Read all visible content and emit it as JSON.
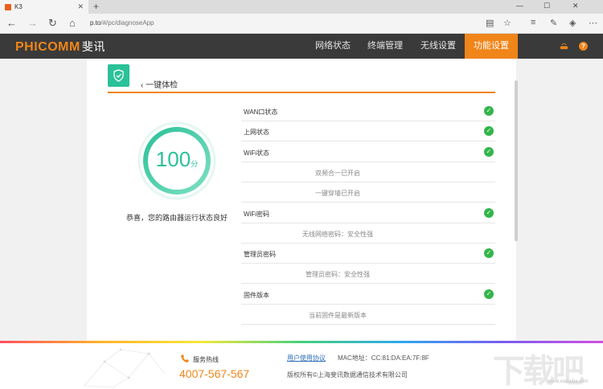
{
  "browser": {
    "tab_title": "K3",
    "url_host": "p.to",
    "url_path": "/#/pc/diagnoseApp"
  },
  "header": {
    "logo": "PHICOMM",
    "logo_cn": "斐讯",
    "nav": [
      {
        "label": "网络状态"
      },
      {
        "label": "终端管理"
      },
      {
        "label": "无线设置"
      },
      {
        "label": "功能设置"
      }
    ],
    "active_nav": "功能设置"
  },
  "page": {
    "title": "一键体检",
    "score": "100",
    "score_unit": "分",
    "message": "恭喜，您的路由器运行状态良好"
  },
  "checks": [
    {
      "label": "WAN口状态",
      "ok": true
    },
    {
      "label": "上网状态",
      "ok": true
    },
    {
      "label": "WiFi状态",
      "ok": true
    },
    {
      "sub": "双频合一已开启"
    },
    {
      "sub": "一键穿墙已开启"
    },
    {
      "label": "WiFi密码",
      "ok": true
    },
    {
      "sub": "无线网络密码：安全性强"
    },
    {
      "label": "管理员密码",
      "ok": true
    },
    {
      "sub": "管理员密码：安全性强"
    },
    {
      "label": "固件版本",
      "ok": true
    },
    {
      "sub": "当前固件是最新版本"
    }
  ],
  "footer": {
    "hotline_label": "服务热线",
    "hotline": "4007-567-567",
    "agreement": "用户使用协议",
    "mac": "MAC地址：CC:81:DA:EA:7F:8F",
    "copyright": "版权所有©上海斐讯数据通信技术有限公司"
  },
  "watermark": {
    "text": "下载吧",
    "url": "www.xiazaiba.com"
  },
  "colors": {
    "accent": "#f08519",
    "success": "#33b54a",
    "teal": "#2bc199",
    "header_bg": "#3a3a3a"
  }
}
